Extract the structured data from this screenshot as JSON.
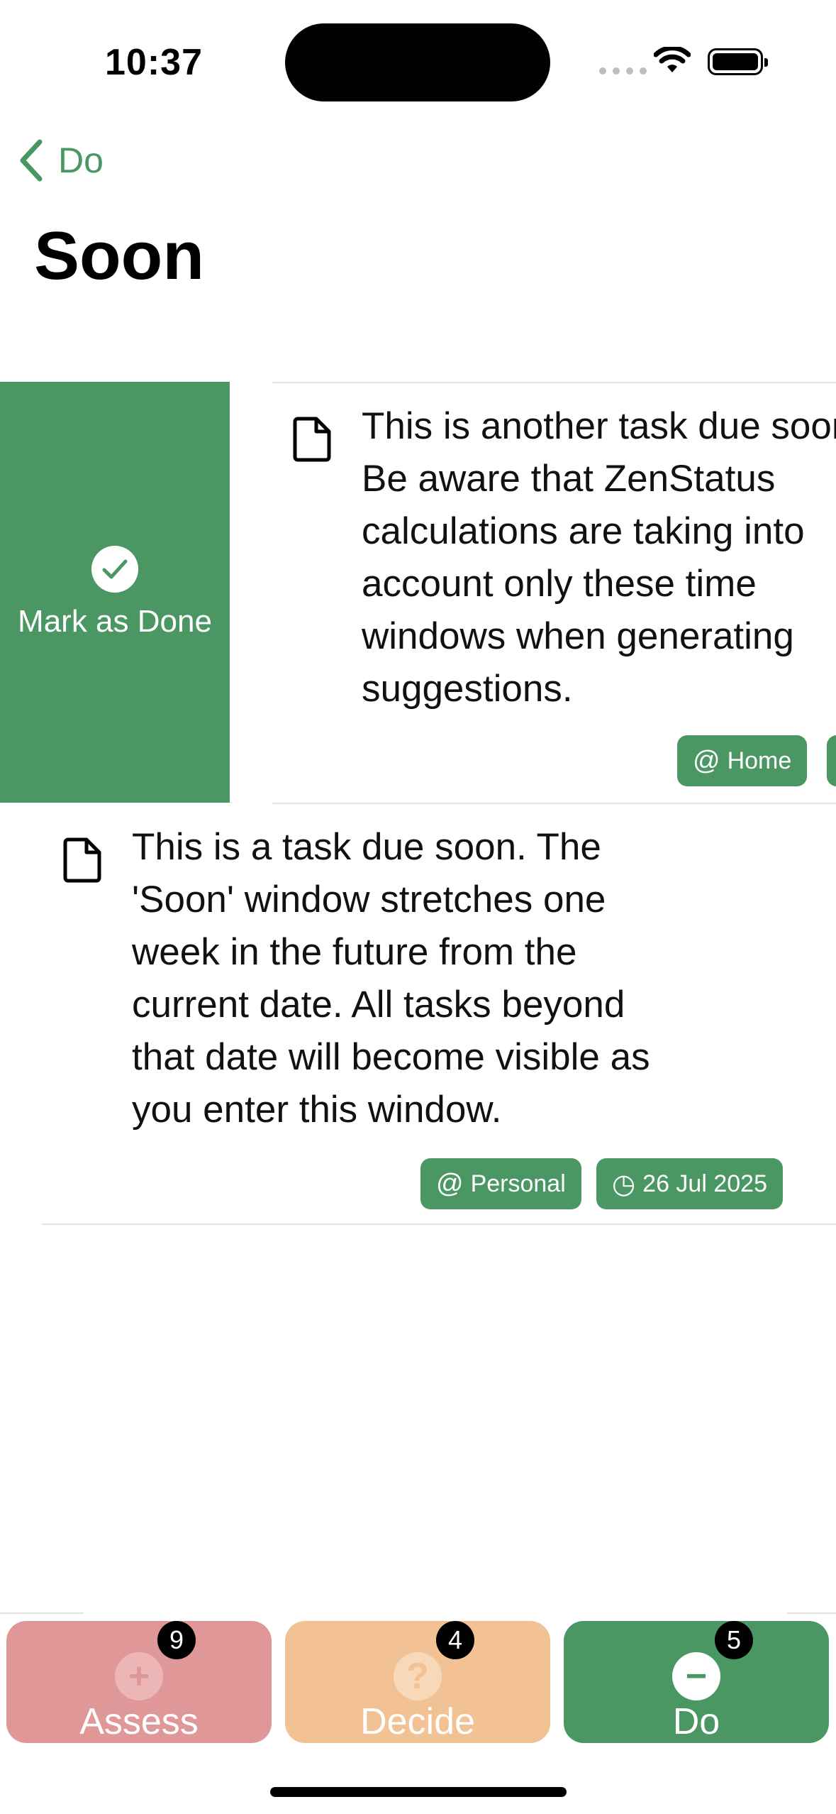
{
  "status_bar": {
    "time": "10:37"
  },
  "nav": {
    "back_label": "Do",
    "title": "Soon"
  },
  "swipe_action": {
    "label": "Mark as Done"
  },
  "tasks": [
    {
      "lines": [
        "This is another task due soon.",
        "Be aware that ZenStatus",
        "calculations are taking into",
        "account only these time",
        "windows when generating",
        "suggestions."
      ],
      "tags": [
        {
          "glyph": "@",
          "label": "Home"
        }
      ]
    },
    {
      "lines": [
        "This is a task due soon. The",
        "'Soon' window stretches one",
        "week in the future from the",
        "current date. All tasks beyond",
        "that date will become visible as",
        "you enter this window."
      ],
      "tags": [
        {
          "glyph": "@",
          "label": "Personal"
        },
        {
          "glyph": "◷",
          "label": "26 Jul 2025"
        }
      ]
    }
  ],
  "tab_bar": {
    "tabs": [
      {
        "label": "Assess",
        "icon": "plus-icon",
        "icon_glyph": "+",
        "badge": "9",
        "color": "#e09798"
      },
      {
        "label": "Decide",
        "icon": "question-icon",
        "icon_glyph": "?",
        "badge": "4",
        "color": "#f2c295"
      },
      {
        "label": "Do",
        "icon": "minus-icon",
        "icon_glyph": "−",
        "badge": "5",
        "color": "#4a9763"
      }
    ]
  },
  "colors": {
    "accent": "#4a9763"
  }
}
